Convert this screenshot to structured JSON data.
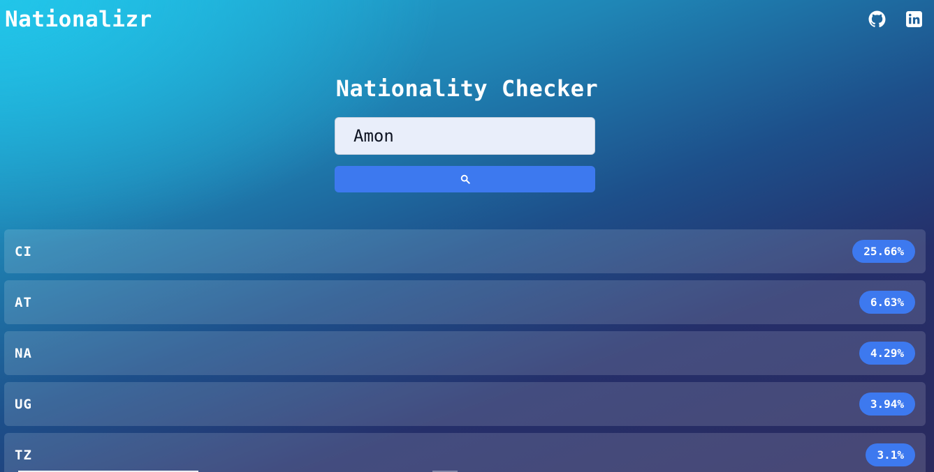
{
  "header": {
    "brand": "Nationalizr",
    "links": [
      {
        "name": "github-icon"
      },
      {
        "name": "linkedin-icon"
      }
    ]
  },
  "main": {
    "title": "Nationality Checker",
    "search": {
      "value": "Amon",
      "button_icon": "search-icon"
    },
    "results": [
      {
        "country": "CI",
        "percent": "25.66%"
      },
      {
        "country": "AT",
        "percent": "6.63%"
      },
      {
        "country": "NA",
        "percent": "4.29%"
      },
      {
        "country": "UG",
        "percent": "3.94%"
      },
      {
        "country": "TZ",
        "percent": "3.1%"
      }
    ]
  },
  "colors": {
    "accent": "#3d79ef",
    "input_bg": "#e9eefa",
    "gradient_start": "#1fb6df",
    "gradient_end": "#2a2a5e"
  }
}
